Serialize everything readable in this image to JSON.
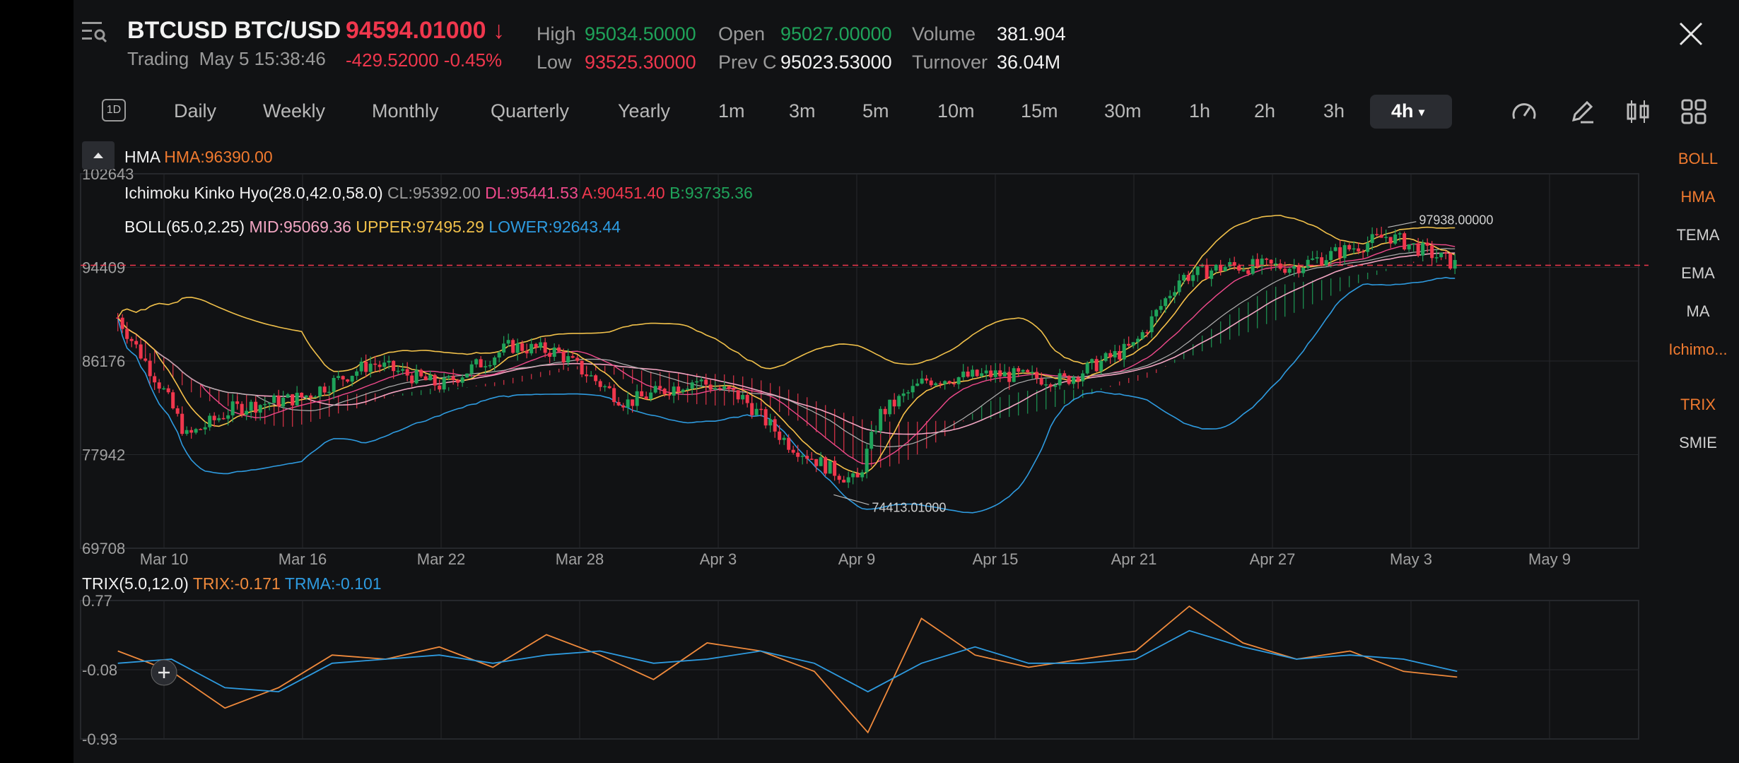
{
  "header": {
    "symbol": "BTCUSD BTC/USD",
    "status": "Trading",
    "datetime": "May 5 15:38:46",
    "price": "94594.01000",
    "price_arrow": "↓",
    "change": "-429.52000",
    "change_pct": "-0.45%",
    "high_label": "High",
    "high_value": "95034.50000",
    "low_label": "Low",
    "low_value": "93525.30000",
    "open_label": "Open",
    "open_value": "95027.00000",
    "prevc_label": "Prev C",
    "prevc_value": "95023.53000",
    "volume_label": "Volume",
    "volume_value": "381.904",
    "turnover_label": "Turnover",
    "turnover_value": "36.04M"
  },
  "periods": {
    "day_icon": "1D",
    "items": [
      "Daily",
      "Weekly",
      "Monthly",
      "Quarterly",
      "Yearly",
      "1m",
      "3m",
      "5m",
      "10m",
      "15m",
      "30m",
      "1h",
      "2h",
      "3h"
    ],
    "active": "4h"
  },
  "indicators": {
    "hma_name": "HMA",
    "hma_value": "HMA:96390.00",
    "ichimoku_name": "Ichimoku Kinko Hyo(28.0,42.0,58.0)",
    "ichimoku_cl": "CL:95392.00",
    "ichimoku_dl": "DL:95441.53",
    "ichimoku_a": "A:90451.40",
    "ichimoku_b": "B:93735.36",
    "boll_name": "BOLL(65.0,2.25)",
    "boll_mid": "MID:95069.36",
    "boll_upper": "UPPER:97495.29",
    "boll_lower": "LOWER:92643.44",
    "trix_name": "TRIX(5.0,12.0)",
    "trix_value": "TRIX:-0.171",
    "trma_value": "TRMA:-0.101"
  },
  "right_panel": {
    "items": [
      "BOLL",
      "HMA",
      "TEMA",
      "EMA",
      "MA",
      "Ichimo...",
      "TRIX",
      "SMIE"
    ],
    "active": [
      "BOLL",
      "HMA",
      "Ichimo...",
      "TRIX"
    ]
  },
  "chart_data": [
    {
      "type": "candlestick",
      "y_ticks": [
        "102643",
        "94409",
        "86176",
        "77942",
        "69708"
      ],
      "ylim": [
        69708,
        102643
      ],
      "x_ticks": [
        "Mar 10",
        "Mar 16",
        "Mar 22",
        "Mar 28",
        "Apr 3",
        "Apr 9",
        "Apr 15",
        "Apr 21",
        "Apr 27",
        "May 3",
        "May 9"
      ],
      "current_price_line": 94594.01,
      "high_marker": "97938.00000",
      "low_marker": "74413.01000",
      "colors": {
        "up": "#1fa35a",
        "down": "#f0374d",
        "boll_mid": "#f3a6c3",
        "boll_upper": "#f0c04a",
        "boll_lower": "#2e9be0",
        "hma": "#f7c14a",
        "ichimoku_cl": "#b0b0b0",
        "ichimoku_dl": "#f04a8c"
      },
      "close_series": [
        {
          "date": "Mar 8",
          "close": 90000
        },
        {
          "date": "Mar 10",
          "close": 83500
        },
        {
          "date": "Mar 11",
          "close": 79500
        },
        {
          "date": "Mar 13",
          "close": 82000
        },
        {
          "date": "Mar 16",
          "close": 83000
        },
        {
          "date": "Mar 19",
          "close": 86000
        },
        {
          "date": "Mar 22",
          "close": 84000
        },
        {
          "date": "Mar 25",
          "close": 87500
        },
        {
          "date": "Mar 27",
          "close": 87000
        },
        {
          "date": "Mar 30",
          "close": 82500
        },
        {
          "date": "Apr 2",
          "close": 84500
        },
        {
          "date": "Apr 4",
          "close": 83000
        },
        {
          "date": "Apr 6",
          "close": 79000
        },
        {
          "date": "Apr 8",
          "close": 76500
        },
        {
          "date": "Apr 9",
          "close": 75500
        },
        {
          "date": "Apr 10",
          "close": 81500
        },
        {
          "date": "Apr 12",
          "close": 84500
        },
        {
          "date": "Apr 15",
          "close": 85000
        },
        {
          "date": "Apr 18",
          "close": 84500
        },
        {
          "date": "Apr 21",
          "close": 87500
        },
        {
          "date": "Apr 23",
          "close": 93500
        },
        {
          "date": "Apr 25",
          "close": 94500
        },
        {
          "date": "Apr 28",
          "close": 94500
        },
        {
          "date": "May 1",
          "close": 96500
        },
        {
          "date": "May 2",
          "close": 97200
        },
        {
          "date": "May 4",
          "close": 95500
        },
        {
          "date": "May 5",
          "close": 94594
        }
      ]
    },
    {
      "type": "line",
      "title": "TRIX(5.0,12.0)",
      "y_ticks": [
        "0.77",
        "-0.08",
        "-0.93"
      ],
      "ylim": [
        -0.93,
        0.77
      ],
      "series": [
        {
          "name": "TRIX",
          "color": "#f08a3c",
          "values": [
            0.15,
            -0.1,
            -0.55,
            -0.3,
            0.1,
            0.05,
            0.2,
            -0.05,
            0.35,
            0.1,
            -0.2,
            0.25,
            0.15,
            -0.1,
            -0.85,
            0.55,
            0.1,
            -0.05,
            0.05,
            0.15,
            0.7,
            0.25,
            0.05,
            0.15,
            -0.1,
            -0.17
          ]
        },
        {
          "name": "TRMA",
          "color": "#2e9be0",
          "values": [
            0.0,
            0.05,
            -0.3,
            -0.35,
            0.0,
            0.05,
            0.1,
            0.0,
            0.1,
            0.15,
            0.0,
            0.05,
            0.15,
            0.0,
            -0.35,
            0.0,
            0.2,
            0.0,
            0.0,
            0.05,
            0.4,
            0.2,
            0.05,
            0.1,
            0.05,
            -0.1
          ]
        }
      ]
    }
  ]
}
